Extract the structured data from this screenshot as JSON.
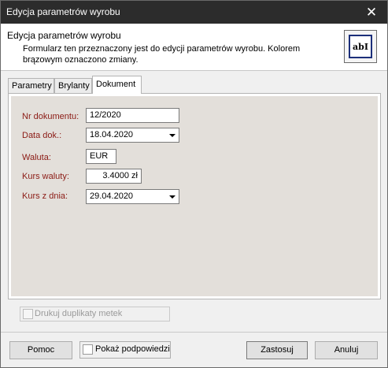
{
  "window": {
    "title": "Edycja parametrów wyrobu",
    "close_symbol": "✕"
  },
  "header": {
    "title": "Edycja parametrów wyrobu",
    "description": "Formularz ten przeznaczony jest do edycji parametrów wyrobu. Kolorem brązowym oznaczono zmiany.",
    "icon": "text-field-icon",
    "icon_glyph": "abI"
  },
  "tabs": [
    {
      "label": "Parametry",
      "active": false
    },
    {
      "label": "Brylanty",
      "active": false
    },
    {
      "label": "Dokument",
      "active": true
    }
  ],
  "form": {
    "nr_dokumentu": {
      "label": "Nr dokumentu:",
      "value": "12/2020"
    },
    "data_dok": {
      "label": "Data dok.:",
      "value": "18.04.2020"
    },
    "waluta": {
      "label": "Waluta:",
      "value": "EUR"
    },
    "kurs_waluty": {
      "label": "Kurs waluty:",
      "value": "3.4000 zł"
    },
    "kurs_z_dnia": {
      "label": "Kurs z dnia:",
      "value": "29.04.2020"
    }
  },
  "drukuj_duplikaty": {
    "label": "Drukuj duplikaty metek",
    "checked": false,
    "disabled": true
  },
  "footer": {
    "help_label": "Pomoc",
    "hints_label": "Pokaż podpowiedzi",
    "hints_checked": false,
    "apply_label": "Zastosuj",
    "cancel_label": "Anuluj"
  },
  "colors": {
    "changed_label": "#8b1a14",
    "titlebar": "#2c2c2c",
    "panel_bg": "#e3dfda"
  }
}
